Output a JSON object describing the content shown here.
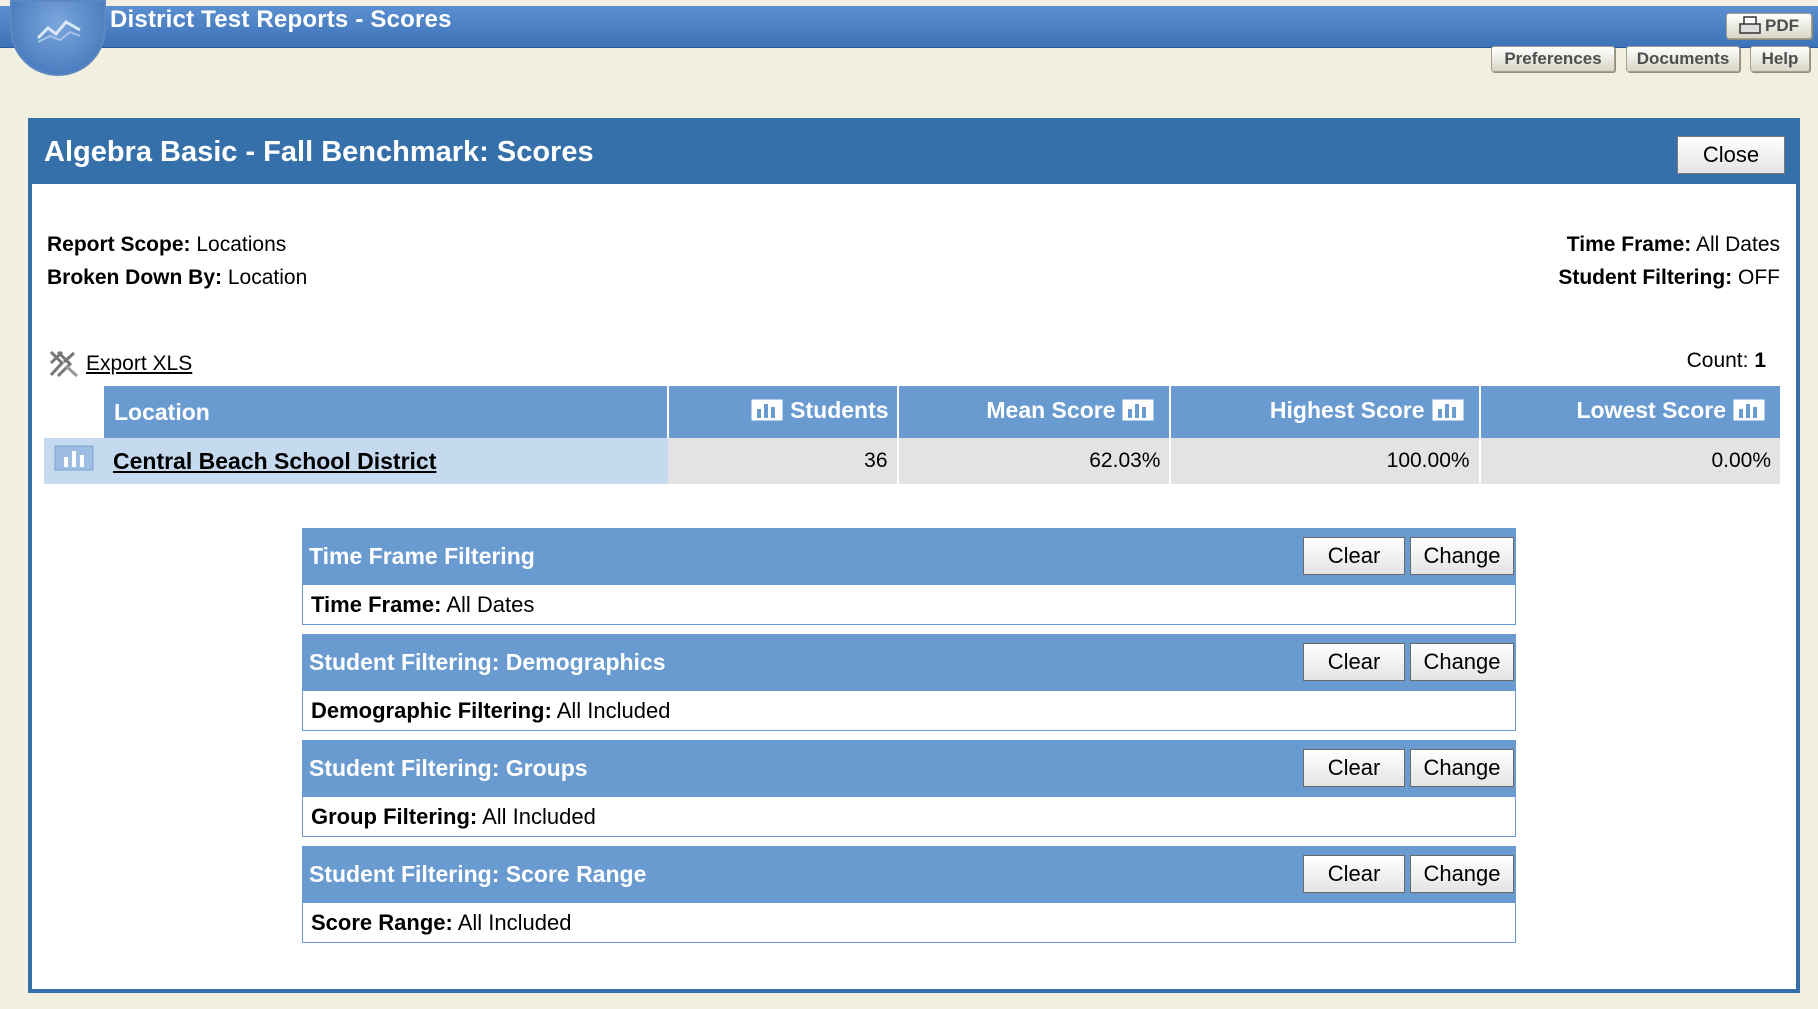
{
  "app": {
    "title": "District Test Reports - Scores",
    "pdf_label": "PDF",
    "preferences_label": "Preferences",
    "documents_label": "Documents",
    "help_label": "Help"
  },
  "report": {
    "title": "Algebra Basic - Fall Benchmark: Scores",
    "close_label": "Close",
    "scope_label": "Report Scope:",
    "scope_value": "Locations",
    "broken_label": "Broken Down By:",
    "broken_value": "Location",
    "timeframe_label": "Time Frame:",
    "timeframe_value": "All Dates",
    "student_filter_label": "Student Filtering:",
    "student_filter_value": "OFF",
    "export_label": "Export XLS",
    "count_label": "Count:",
    "count_value": "1"
  },
  "table": {
    "columns": [
      "Location",
      "Students",
      "Mean Score",
      "Highest Score",
      "Lowest Score"
    ],
    "rows": [
      {
        "location": "Central Beach School District",
        "students": "36",
        "mean": "62.03%",
        "highest": "100.00%",
        "lowest": "0.00%"
      }
    ]
  },
  "filters": {
    "clear_label": "Clear",
    "change_label": "Change",
    "items": [
      {
        "title": "Time Frame Filtering",
        "label": "Time Frame:",
        "value": "All Dates"
      },
      {
        "title": "Student Filtering: Demographics",
        "label": "Demographic Filtering:",
        "value": "All Included"
      },
      {
        "title": "Student Filtering: Groups",
        "label": "Group Filtering:",
        "value": "All Included"
      },
      {
        "title": "Student Filtering: Score Range",
        "label": "Score Range:",
        "value": "All Included"
      }
    ]
  },
  "colors": {
    "header_blue": "#3670ab",
    "column_blue": "#6a9bd0",
    "row_highlight": "#c5d9ef",
    "cell_gray": "#e3e3e3"
  }
}
